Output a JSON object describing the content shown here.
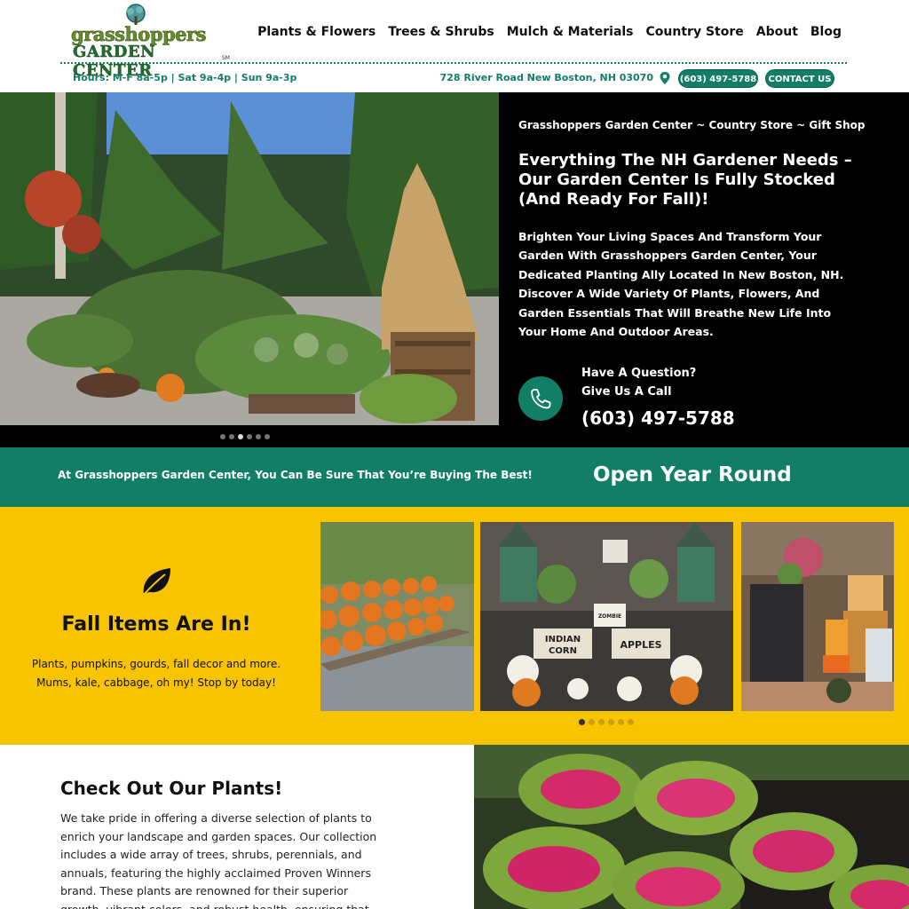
{
  "brand": {
    "logo_line1": "grasshoppers",
    "logo_line2": "GARDEN CENTER",
    "logo_mark": "SM",
    "colors": {
      "primary_green": "#137e66",
      "yellow": "#f8c400",
      "hero_bg": "#000000"
    }
  },
  "nav": {
    "items": [
      "Plants & Flowers",
      "Trees & Shrubs",
      "Mulch & Materials",
      "Country Store",
      "About",
      "Blog"
    ]
  },
  "infobar": {
    "hours": "Hours: M-F 8a-5p | Sat 9a-4p | Sun 9a-3p",
    "address": "728 River Road New Boston, NH 03070",
    "address_icon": "map-pin-icon",
    "phone_pill": "(603) 497-5788",
    "contact_pill": "CONTACT US"
  },
  "hero": {
    "eyebrow": "Grasshoppers Garden Center ~ Country Store ~ Gift Shop",
    "headline": "Everything The NH Gardener Needs – Our Garden Center Is Fully Stocked (And Ready For Fall)!",
    "body": "Brighten Your Living Spaces And Transform Your Garden With Grasshoppers Garden Center, Your Dedicated Planting Ally Located In New Boston, NH. Discover A Wide Variety Of Plants, Flowers, And Garden Essentials That Will Breathe New Life Into Your Home And Outdoor Areas.",
    "call_line1": "Have A Question?",
    "call_line2": "Give Us A Call",
    "call_number": "(603) 497-5788",
    "call_icon": "phone-icon",
    "slide_count": 6,
    "active_slide": 3
  },
  "band": {
    "tagline": "At Grasshoppers Garden Center, You Can Be Sure That You’re Buying The Best!",
    "open": "Open Year Round"
  },
  "fall": {
    "icon": "leaf-icon",
    "title": "Fall Items Are In!",
    "line1": "Plants, pumpkins, gourds, fall decor and more.",
    "line2": "Mums, kale, cabbage, oh my! Stop by today!",
    "sign_indian": "INDIAN",
    "sign_corn": "CORN",
    "sign_apples": "APPLES",
    "sign_zombie": "ZOMBIE",
    "slide_count": 6,
    "active_slide": 1
  },
  "plants": {
    "title": "Check Out Our Plants!",
    "body": "We take pride in offering a diverse selection of plants to enrich your landscape and garden spaces. Our collection includes a wide array of trees, shrubs, perennials, and annuals, featuring the highly acclaimed Proven Winners brand. These plants are renowned for their superior growth, vibrant colors, and robust health, ensuring that"
  }
}
